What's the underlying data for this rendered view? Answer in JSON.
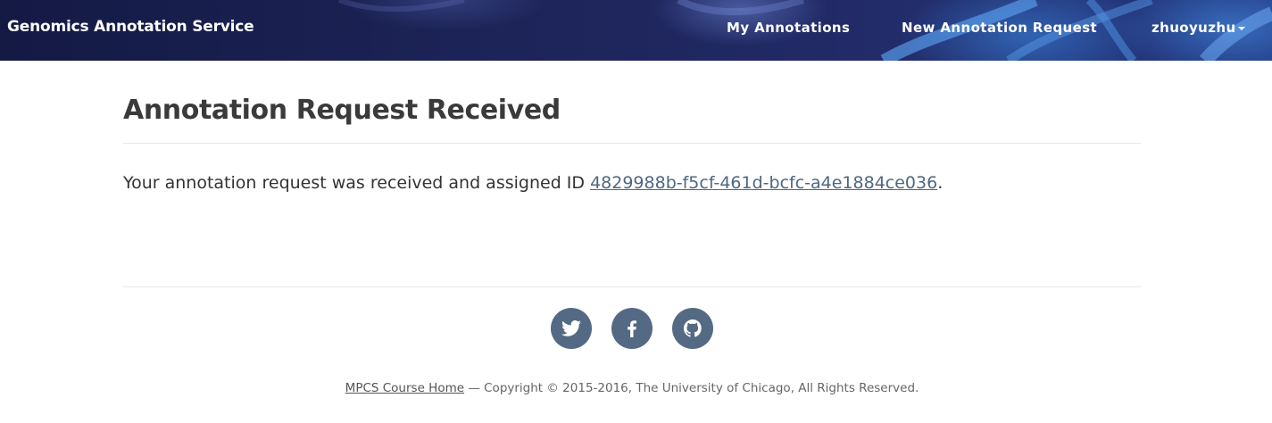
{
  "navbar": {
    "brand": "Genomics Annotation Service",
    "links": {
      "my_annotations": "My Annotations",
      "new_request": "New Annotation Request",
      "user": "zhuoyuzhu"
    }
  },
  "main": {
    "title": "Annotation Request Received",
    "message_prefix": "Your annotation request was received and assigned ID ",
    "request_id": "4829988b-f5cf-461d-bcfc-a4e1884ce036",
    "message_suffix": "."
  },
  "footer": {
    "social": [
      "twitter-icon",
      "facebook-icon",
      "github-icon"
    ],
    "course_link": "MPCS Course Home",
    "copyright": " — Copyright © 2015-2016, The University of Chicago, All Rights Reserved."
  },
  "colors": {
    "navbar_dark": "#1d2458",
    "link": "#4f6782",
    "social_bg": "#546a84"
  }
}
